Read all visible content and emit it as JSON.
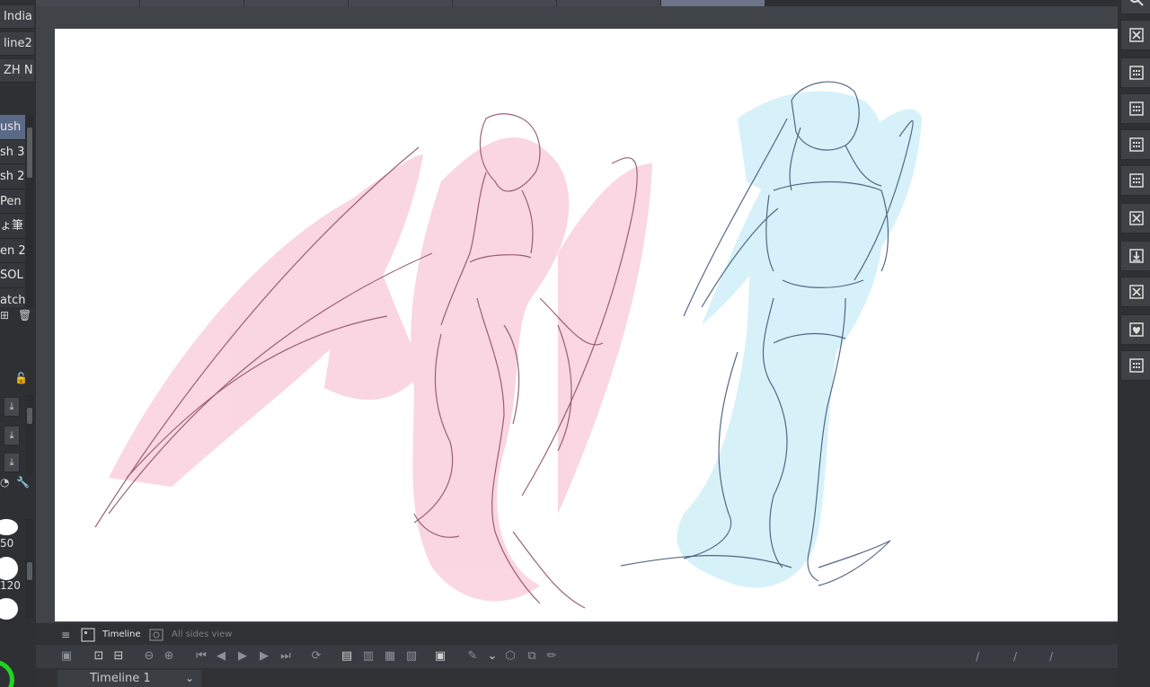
{
  "left_panel": {
    "top_items": [
      "India",
      "line2",
      "ZH N"
    ],
    "brushes": [
      "ush",
      "sh 3",
      "sh 2",
      "Pen",
      "ょ筆",
      "en 2",
      "SOL",
      "atch"
    ],
    "sizes": [
      "50",
      "120"
    ]
  },
  "timeline": {
    "tab_active": "Timeline",
    "tab_inactive": "All sides view",
    "selector": "Timeline 1",
    "markers": [
      "/",
      "/",
      "/"
    ]
  },
  "icons": {
    "right_column": [
      "search-icon",
      "close-file-icon",
      "calendar-grid-icon",
      "calendar-grid-icon",
      "calendar-grid-icon",
      "calendar-grid-icon",
      "close-file-icon",
      "download-icon",
      "close-file-icon",
      "heart-folder-icon",
      "calendar-grid-icon"
    ]
  },
  "colors": {
    "pink_fill": "#f8c9d8",
    "blue_fill": "#cdeef8",
    "pink_line": "#8a4a5e",
    "blue_line": "#3b4e6e",
    "selected": "#5a6a86",
    "accent_green": "#22d321"
  }
}
